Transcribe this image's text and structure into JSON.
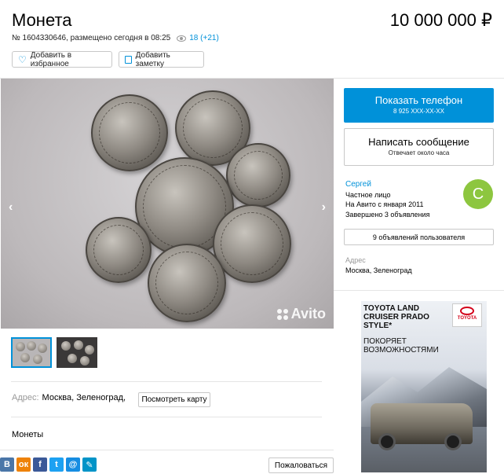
{
  "listing": {
    "title": "Монета",
    "price": "10 000 000 ₽",
    "meta": "№ 1604330646, размещено сегодня в 08:25",
    "views": "18 (+21)"
  },
  "actions": {
    "favorite_label": "Добавить в избранное",
    "note_label": "Добавить заметку"
  },
  "gallery": {
    "watermark": "Avito",
    "prev_arrow": "‹",
    "next_arrow": "›"
  },
  "details": {
    "address_label": "Адрес:",
    "address_value": "Москва, Зеленоград,",
    "map_button": "Посмотреть карту",
    "category": "Монеты"
  },
  "share": {
    "icons": [
      {
        "name": "vk-icon",
        "glyph": "В",
        "color": "#4a76a8"
      },
      {
        "name": "ok-icon",
        "glyph": "ок",
        "color": "#ee8208"
      },
      {
        "name": "facebook-icon",
        "glyph": "f",
        "color": "#3b5998"
      },
      {
        "name": "twitter-icon",
        "glyph": "t",
        "color": "#1da1f2"
      },
      {
        "name": "mail-icon",
        "glyph": "@",
        "color": "#168de2"
      },
      {
        "name": "livejournal-icon",
        "glyph": "✎",
        "color": "#0094c8"
      }
    ],
    "report_label": "Пожаловаться"
  },
  "contact": {
    "phone_button": "Показать телефон",
    "phone_masked": "8 925 XXX-XX-XX",
    "message_button": "Написать сообщение",
    "message_sub": "Отвечает около часа"
  },
  "seller": {
    "name": "Сергей",
    "type": "Частное лицо",
    "since": "На Авито с января 2011",
    "completed": "Завершено 3 объявления",
    "avatar_letter": "С",
    "ads_button": "9 объявлений пользователя",
    "address_label": "Адрес",
    "address_value": "Москва, Зеленоград"
  },
  "advert": {
    "headline": "TOYOTA LAND CRUISER PRADO STYLE*",
    "tagline": "ПОКОРЯЕТ ВОЗМОЖНОСТЯМИ",
    "brand": "TOYOTA"
  },
  "colors": {
    "accent": "#0091d9",
    "avatar": "#8dc63f"
  }
}
